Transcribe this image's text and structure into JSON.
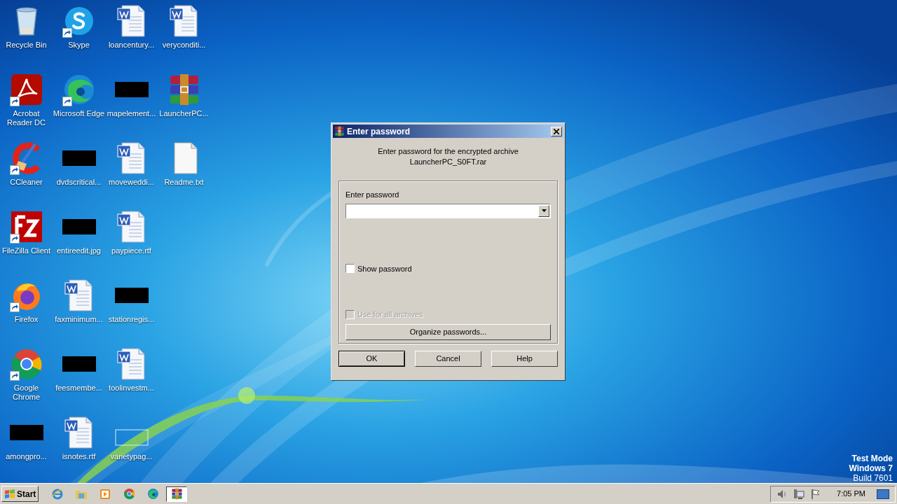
{
  "desktop_columns": [
    [
      {
        "label_lines": [
          "Recycle Bin"
        ],
        "kind": "recycle",
        "shortcut": false
      },
      {
        "label_lines": [
          "Acrobat",
          "Reader DC"
        ],
        "kind": "pdf",
        "shortcut": true
      },
      {
        "label_lines": [
          "CCleaner"
        ],
        "kind": "ccleaner",
        "shortcut": true
      },
      {
        "label_lines": [
          "FileZilla Client"
        ],
        "kind": "filezilla",
        "shortcut": true
      },
      {
        "label_lines": [
          "Firefox"
        ],
        "kind": "firefox",
        "shortcut": true
      },
      {
        "label_lines": [
          "Google",
          "Chrome"
        ],
        "kind": "chrome",
        "shortcut": true
      },
      {
        "label_lines": [
          "amongpro..."
        ],
        "kind": "hidden",
        "shortcut": false
      }
    ],
    [
      {
        "label_lines": [
          "Skype"
        ],
        "kind": "skype",
        "shortcut": true
      },
      {
        "label_lines": [
          "Microsoft Edge"
        ],
        "kind": "edge",
        "shortcut": true
      },
      {
        "label_lines": [
          "dvdscritical..."
        ],
        "kind": "hidden",
        "shortcut": false
      },
      {
        "label_lines": [
          "entireedit.jpg"
        ],
        "kind": "hidden",
        "shortcut": false
      },
      {
        "label_lines": [
          "faxminimum..."
        ],
        "kind": "word",
        "shortcut": false
      },
      {
        "label_lines": [
          "feesmembe..."
        ],
        "kind": "hidden",
        "shortcut": false
      },
      {
        "label_lines": [
          "isnotes.rtf"
        ],
        "kind": "word",
        "shortcut": false
      }
    ],
    [
      {
        "label_lines": [
          "loancentury..."
        ],
        "kind": "word",
        "shortcut": false
      },
      {
        "label_lines": [
          "mapelement..."
        ],
        "kind": "hidden",
        "shortcut": false
      },
      {
        "label_lines": [
          "moveweddi..."
        ],
        "kind": "word",
        "shortcut": false
      },
      {
        "label_lines": [
          "paypiece.rtf"
        ],
        "kind": "word",
        "shortcut": false
      },
      {
        "label_lines": [
          "stationregis..."
        ],
        "kind": "hidden",
        "shortcut": false
      },
      {
        "label_lines": [
          "toolinvestm..."
        ],
        "kind": "word",
        "shortcut": false
      },
      {
        "label_lines": [
          "varietypag..."
        ],
        "kind": "blank",
        "shortcut": false
      }
    ],
    [
      {
        "label_lines": [
          "veryconditi..."
        ],
        "kind": "word",
        "shortcut": false
      },
      {
        "label_lines": [
          "LauncherPC..."
        ],
        "kind": "rar",
        "shortcut": false
      },
      {
        "label_lines": [
          "Readme.txt"
        ],
        "kind": "text",
        "shortcut": false
      }
    ]
  ],
  "dialog": {
    "title": "Enter password",
    "message": "Enter password for the encrypted archive",
    "archive": "LauncherPC_S0FT.rar",
    "password_label": "Enter password",
    "checkboxes": [
      {
        "label": "Show password",
        "checked": false,
        "disabled": false
      },
      {
        "label": "Use for all archives",
        "checked": false,
        "disabled": true
      }
    ],
    "organize_button": "Organize passwords...",
    "buttons": [
      {
        "label": "OK",
        "default": true
      },
      {
        "label": "Cancel",
        "default": false
      },
      {
        "label": "Help",
        "default": false
      }
    ]
  },
  "system_notice": [
    "Test Mode",
    "Windows 7",
    "Build 7601"
  ],
  "taskbar": {
    "start": "Start",
    "apps": [
      {
        "kind": "ie",
        "selected": false
      },
      {
        "kind": "explorer",
        "selected": false
      },
      {
        "kind": "media",
        "selected": false
      },
      {
        "kind": "chrome",
        "selected": false
      },
      {
        "kind": "edge",
        "selected": false
      },
      {
        "kind": "rar",
        "selected": true
      }
    ],
    "tray_icons": [
      {
        "kind": "volume"
      },
      {
        "kind": "network"
      },
      {
        "kind": "flag"
      }
    ],
    "clock": "7:05 PM"
  }
}
